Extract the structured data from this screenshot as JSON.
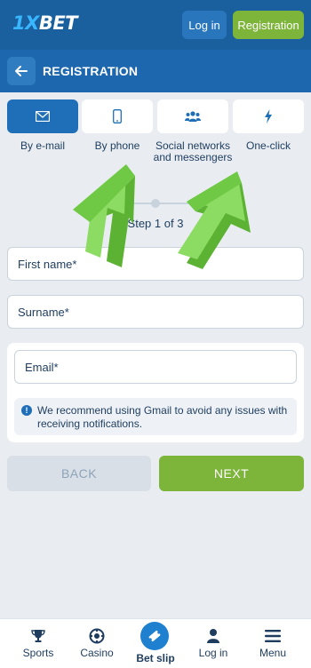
{
  "topbar": {
    "logo_prefix": "1X",
    "logo_suffix": "BET",
    "login_label": "Log in",
    "register_label": "Registration"
  },
  "header": {
    "title": "REGISTRATION",
    "back_icon": "arrow-left-icon"
  },
  "methods": [
    {
      "label": "By e-mail",
      "icon": "envelope-icon",
      "active": true
    },
    {
      "label": "By phone",
      "icon": "phone-icon",
      "active": false
    },
    {
      "label": "Social networks and messengers",
      "icon": "people-icon",
      "active": false
    },
    {
      "label": "One-click",
      "icon": "lightning-icon",
      "active": false
    }
  ],
  "step": {
    "text": "Step 1 of 3"
  },
  "form": {
    "first_name_placeholder": "First name*",
    "surname_placeholder": "Surname*",
    "email_placeholder": "Email*",
    "info_text": "We recommend using Gmail to avoid any issues with receiving notifications."
  },
  "actions": {
    "back_label": "BACK",
    "next_label": "NEXT"
  },
  "bottom_nav": {
    "sports": "Sports",
    "casino": "Casino",
    "betslip": "Bet slip",
    "login": "Log in",
    "menu": "Menu"
  },
  "colors": {
    "primary": "#1d67ae",
    "accent_green": "#7db43a",
    "overlay_arrow": "#7fd65a",
    "background": "#e9edf1"
  }
}
